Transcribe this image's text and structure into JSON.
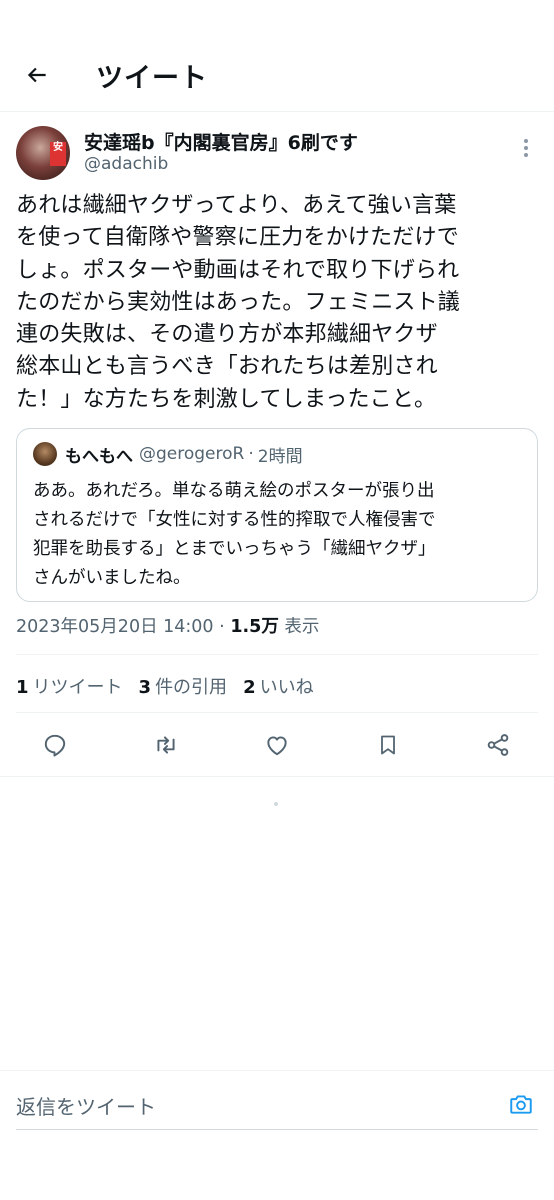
{
  "header": {
    "title": "ツイート",
    "back_icon": "arrow-left-icon"
  },
  "author": {
    "display_name": "安達瑶b『内閣裏官房』6刷です",
    "handle": "@adachib",
    "avatar_badge": "安"
  },
  "tweet": {
    "text": "あれは繊細ヤクザってより、あえて強い言葉\nを使って自衛隊や警察に圧力をかけただけで\nしょ。ポスターや動画はそれで取り下げられ\nたのだから実効性はあった。フェミニスト議\n連の失敗は、その遣り方が本邦繊細ヤクザ\n総本山とも言うべき「おれたちは差別され\nた！」な方たちを刺激してしまったこと。"
  },
  "quote": {
    "name": "もへもへ",
    "handle": "@gerogeroR",
    "dot": "·",
    "time": "2時間",
    "text": "ああ。あれだろ。単なる萌え絵のポスターが張り出\nされるだけで「女性に対する性的搾取で人権侵害で\n犯罪を助長する」とまでいっちゃう「繊細ヤクザ」\nさんがいましたね。"
  },
  "meta": {
    "datetime": "2023年05月20日 14:00",
    "dot": "·",
    "views_count": "1.5万",
    "views_label": "表示"
  },
  "stats": {
    "retweets_count": "1",
    "retweets_label": "リツイート",
    "quotes_count": "3",
    "quotes_label": "件の引用",
    "likes_count": "2",
    "likes_label": "いいね"
  },
  "actions": [
    "reply-icon",
    "retweet-icon",
    "like-icon",
    "bookmark-icon",
    "share-icon"
  ],
  "reply": {
    "placeholder": "返信をツイート",
    "camera_icon": "camera-icon"
  },
  "colors": {
    "text": "#0f1419",
    "secondary": "#536471",
    "accent": "#1d9bf0",
    "border": "#cfd9de"
  }
}
